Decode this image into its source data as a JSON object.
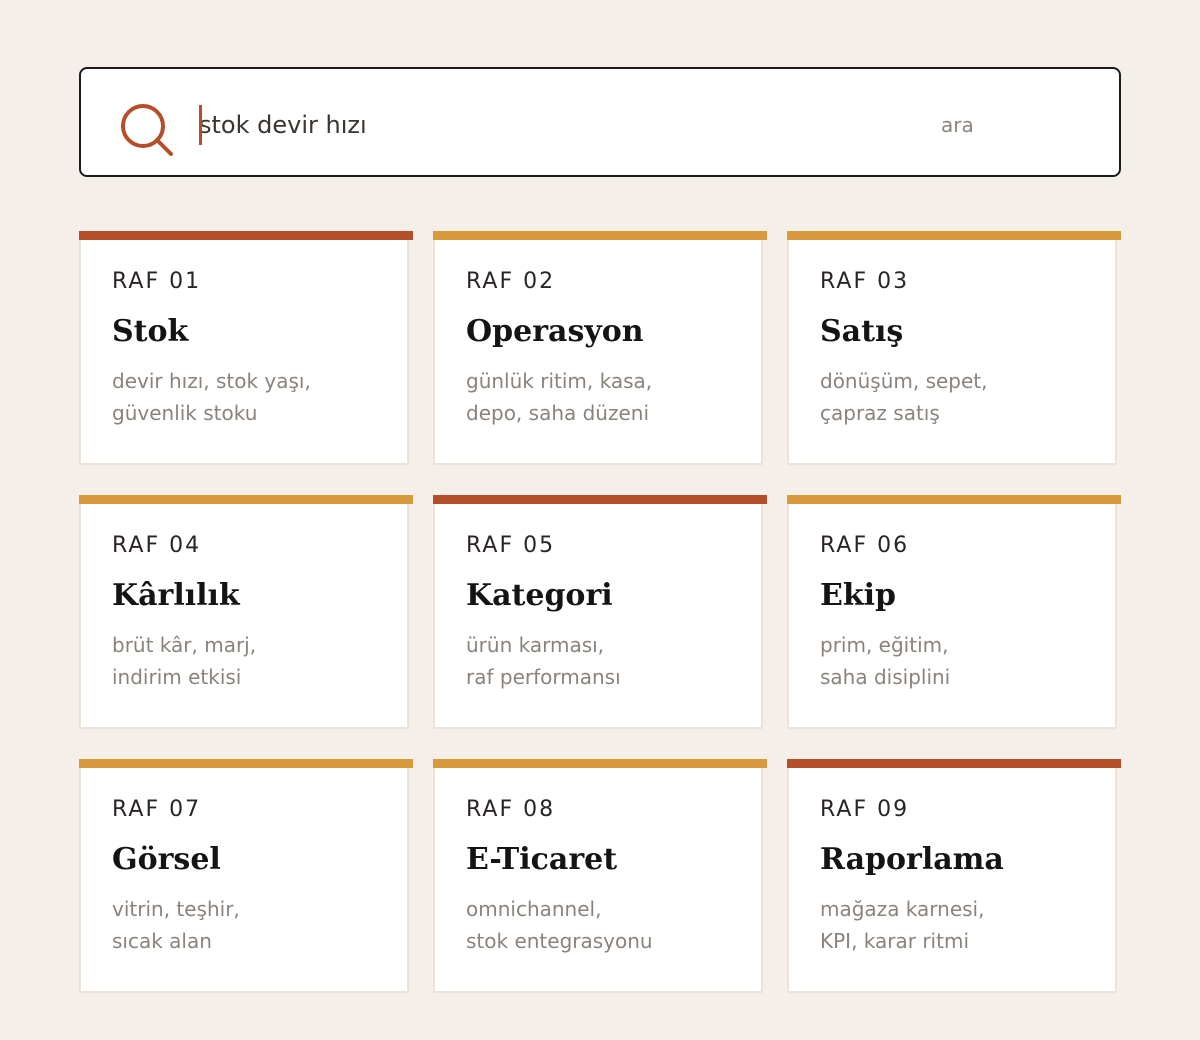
{
  "search": {
    "value": "stok devir hızı",
    "hint": "ara"
  },
  "colors": {
    "accent_rust": "#b44f2a",
    "accent_amber": "#d99a3e",
    "background": "#f4efe8"
  },
  "shelves": [
    {
      "label": "RAF 01",
      "title": "Stok",
      "line1": "devir hızı, stok yaşı,",
      "line2": "güvenlik stoku",
      "accent": "rust"
    },
    {
      "label": "RAF 02",
      "title": "Operasyon",
      "line1": "günlük ritim, kasa,",
      "line2": "depo, saha düzeni",
      "accent": "amber"
    },
    {
      "label": "RAF 03",
      "title": "Satış",
      "line1": "dönüşüm, sepet,",
      "line2": "çapraz satış",
      "accent": "amber"
    },
    {
      "label": "RAF 04",
      "title": "Kârlılık",
      "line1": "brüt kâr, marj,",
      "line2": "indirim etkisi",
      "accent": "amber"
    },
    {
      "label": "RAF 05",
      "title": "Kategori",
      "line1": "ürün karması,",
      "line2": "raf performansı",
      "accent": "rust"
    },
    {
      "label": "RAF 06",
      "title": "Ekip",
      "line1": "prim, eğitim,",
      "line2": "saha disiplini",
      "accent": "amber"
    },
    {
      "label": "RAF 07",
      "title": "Görsel",
      "line1": "vitrin, teşhir,",
      "line2": "sıcak alan",
      "accent": "amber"
    },
    {
      "label": "RAF 08",
      "title": "E-Ticaret",
      "line1": "omnichannel,",
      "line2": "stok entegrasyonu",
      "accent": "amber"
    },
    {
      "label": "RAF 09",
      "title": "Raporlama",
      "line1": "mağaza karnesi,",
      "line2": "KPI, karar ritmi",
      "accent": "rust"
    }
  ]
}
